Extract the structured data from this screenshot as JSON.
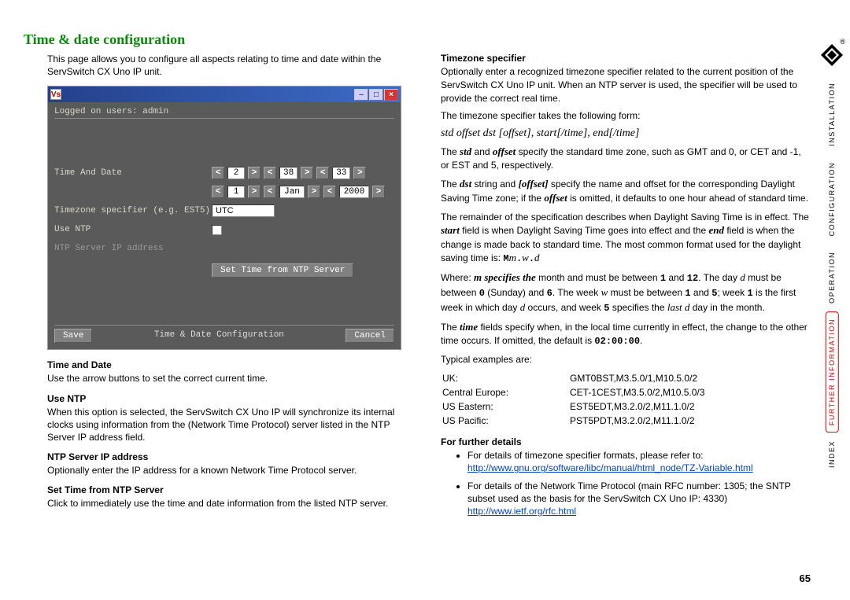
{
  "page_title": "Time & date configuration",
  "intro": "This page allows you to configure all aspects relating to time and date within the ServSwitch CX Uno IP unit.",
  "screenshot": {
    "vnc_initials": "Vs",
    "logged_on_line": "Logged on users: admin",
    "labels": {
      "time_and_date": "Time And Date",
      "tz_specifier": "Timezone specifier (e.g. EST5)",
      "use_ntp": "Use NTP",
      "ntp_server_ip": "NTP Server IP address"
    },
    "time": {
      "hour": "2",
      "min": "38",
      "sec": "33"
    },
    "date": {
      "day": "1",
      "month": "Jan",
      "year": "2000"
    },
    "tz_value": "UTC",
    "set_time_btn": "Set Time from NTP Server",
    "bottom": {
      "save": "Save",
      "status": "Time & Date Configuration",
      "cancel": "Cancel"
    }
  },
  "left_sections": [
    {
      "head": "Time and Date",
      "body": "Use the arrow buttons to set the correct current time."
    },
    {
      "head": "Use NTP",
      "body": "When this option is selected, the ServSwitch CX Uno IP will synchronize its internal clocks using information from the (Network Time Protocol) server listed in the NTP Server IP address field."
    },
    {
      "head": "NTP Server IP address",
      "body": "Optionally enter the IP address for a known Network Time Protocol server."
    },
    {
      "head": "Set Time from NTP Server",
      "body": "Click to immediately use the time and date information from the listed NTP server."
    }
  ],
  "right": {
    "tz_head": "Timezone specifier",
    "tz_para1": "Optionally enter a recognized timezone specifier related to the current position of the ServSwitch CX Uno IP unit. When an NTP server is used, the specifier will be used to provide the correct real time.",
    "tz_para2": "The timezone specifier takes the following form:",
    "tz_form": "std offset dst [offset], start[/time], end[/time]",
    "examples_intro": "Typical examples are:",
    "examples": [
      {
        "region": "UK:",
        "value": "GMT0BST,M3.5.0/1,M10.5.0/2"
      },
      {
        "region": "Central Europe:",
        "value": "CET-1CEST,M3.5.0/2,M10.5.0/3"
      },
      {
        "region": "US Eastern:",
        "value": "EST5EDT,M3.2.0/2,M11.1.0/2"
      },
      {
        "region": "US Pacific:",
        "value": "PST5PDT,M3.2.0/2,M11.1.0/2"
      }
    ],
    "further_head": "For further details",
    "link1_intro": "For details of timezone specifier formats, please refer to:",
    "link1": "http://www.gnu.org/software/libc/manual/html_node/TZ-Variable.html",
    "link2_intro": "For details of the Network Time Protocol (main RFC number: 1305; the SNTP subset used as the basis for the ServSwitch CX Uno IP: 4330)",
    "link2": "http://www.ietf.org/rfc.html"
  },
  "sidenav": {
    "installation": "INSTALLATION",
    "configuration": "CONFIGURATION",
    "operation": "OPERATION",
    "further": "FURTHER INFORMATION",
    "index": "INDEX"
  },
  "page_number": "65",
  "reg": "®"
}
